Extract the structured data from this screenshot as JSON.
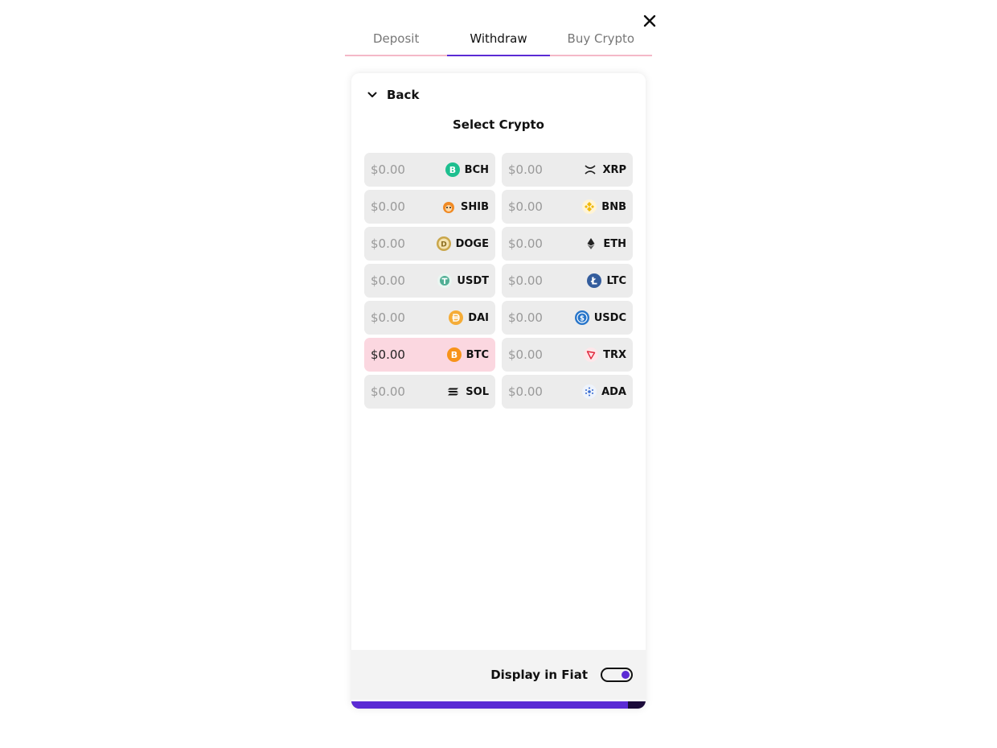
{
  "tabs": [
    {
      "label": "Deposit",
      "active": false
    },
    {
      "label": "Withdraw",
      "active": true
    },
    {
      "label": "Buy Crypto",
      "active": false
    }
  ],
  "card": {
    "back_label": "Back",
    "title": "Select Crypto"
  },
  "coins": [
    {
      "amount": "$0.00",
      "symbol": "BCH",
      "icon": "bch-icon",
      "selected": false
    },
    {
      "amount": "$0.00",
      "symbol": "XRP",
      "icon": "xrp-icon",
      "selected": false
    },
    {
      "amount": "$0.00",
      "symbol": "SHIB",
      "icon": "shib-icon",
      "selected": false
    },
    {
      "amount": "$0.00",
      "symbol": "BNB",
      "icon": "bnb-icon",
      "selected": false
    },
    {
      "amount": "$0.00",
      "symbol": "DOGE",
      "icon": "doge-icon",
      "selected": false
    },
    {
      "amount": "$0.00",
      "symbol": "ETH",
      "icon": "eth-icon",
      "selected": false
    },
    {
      "amount": "$0.00",
      "symbol": "USDT",
      "icon": "usdt-icon",
      "selected": false
    },
    {
      "amount": "$0.00",
      "symbol": "LTC",
      "icon": "ltc-icon",
      "selected": false
    },
    {
      "amount": "$0.00",
      "symbol": "DAI",
      "icon": "dai-icon",
      "selected": false
    },
    {
      "amount": "$0.00",
      "symbol": "USDC",
      "icon": "usdc-icon",
      "selected": false
    },
    {
      "amount": "$0.00",
      "symbol": "BTC",
      "icon": "btc-icon",
      "selected": true
    },
    {
      "amount": "$0.00",
      "symbol": "TRX",
      "icon": "trx-icon",
      "selected": false
    },
    {
      "amount": "$0.00",
      "symbol": "SOL",
      "icon": "sol-icon",
      "selected": false
    },
    {
      "amount": "$0.00",
      "symbol": "ADA",
      "icon": "ada-icon",
      "selected": false
    }
  ],
  "footer": {
    "label": "Display in Fiat",
    "toggle_on": true
  },
  "progress": {
    "percent": 94
  },
  "colors": {
    "accent": "#5b2bd4",
    "selected_bg": "#fbd7e0",
    "tab_underline": "#f4b8c8"
  }
}
